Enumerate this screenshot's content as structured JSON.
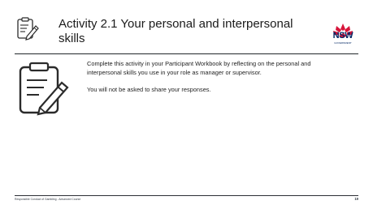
{
  "slide": {
    "title": "Activity 2.1  Your personal and interpersonal skills",
    "logo": {
      "text": "NSW",
      "subtext": "GOVERNMENT",
      "colors": {
        "navy": "#002664",
        "red": "#d7153a"
      }
    },
    "body": {
      "paragraph_1": "Complete this activity in your Participant Workbook by reflecting on the personal and interpersonal skills you use in your role as manager or supervisor.",
      "paragraph_2": "You will not be asked to share your responses."
    },
    "header_icon": "document-pencil-icon",
    "body_icon": "document-pencil-icon",
    "footer": {
      "course": "Responsible Conduct of Gambling - Advanced Course",
      "page_number": "19"
    }
  }
}
